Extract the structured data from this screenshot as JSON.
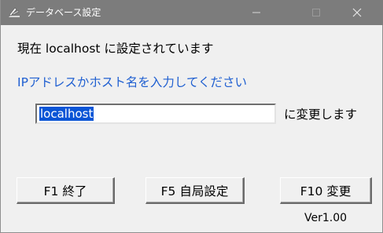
{
  "window": {
    "title": "データベース設定",
    "controls": {
      "minimize": "minimize-icon",
      "maximize": "maximize-icon",
      "close": "close-icon"
    }
  },
  "status": {
    "current_text": "現在 localhost に設定されています"
  },
  "prompt": {
    "text": "IPアドレスかホスト名を入力してください"
  },
  "host_input": {
    "value": "localhost"
  },
  "suffix": "に変更します",
  "buttons": {
    "exit": "F1 終了",
    "local": "F5 自局設定",
    "change": "F10 変更"
  },
  "version": "Ver1.00",
  "colors": {
    "titlebar": "#7c7c7c",
    "prompt_text": "#1f5fd1",
    "selection": "#0a55d6",
    "background": "#f0f0f0"
  }
}
